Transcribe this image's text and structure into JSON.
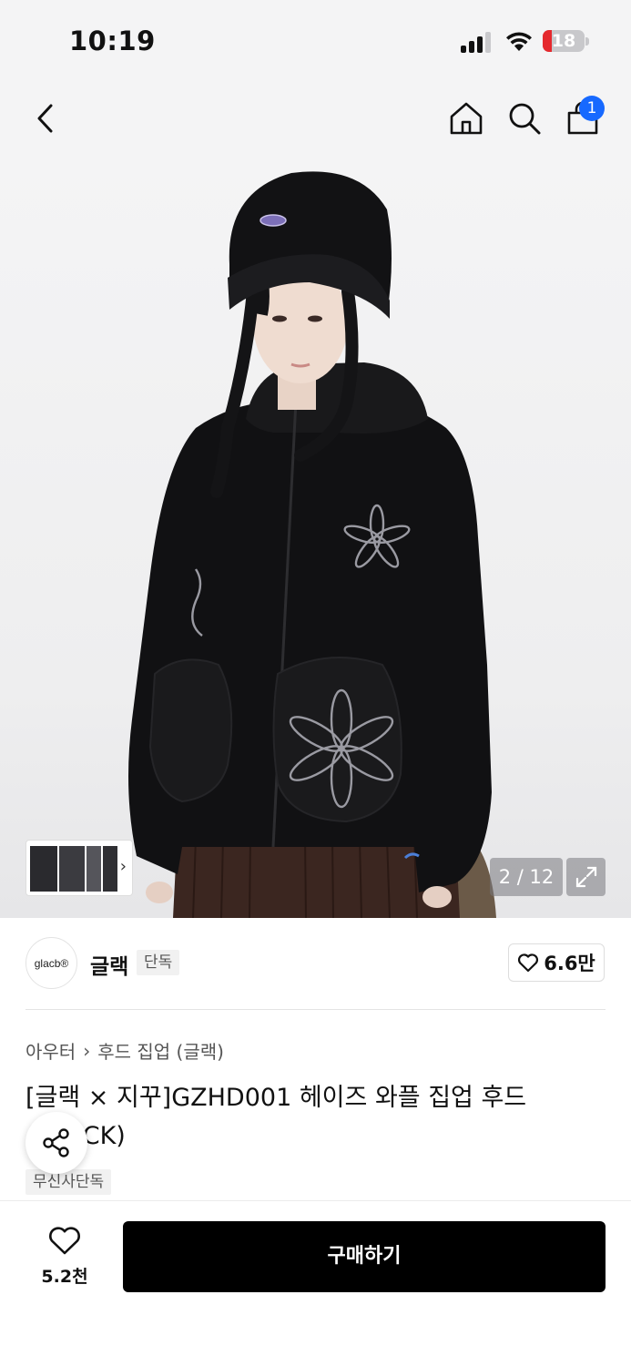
{
  "status_bar": {
    "time": "10:19",
    "battery": "18",
    "battery_color": "#e5292e"
  },
  "nav": {
    "back_icon": "chevron-left-icon",
    "home_icon": "home-icon",
    "search_icon": "search-icon",
    "cart_icon": "shopping-bag-icon",
    "cart_count": "1",
    "badge_color": "#1769ff"
  },
  "gallery": {
    "counter": "2 / 12",
    "current_image": 2,
    "total_images": 12,
    "expand_icon": "expand-icon",
    "thumb_arrow": "›"
  },
  "brand": {
    "logo_text": "glacb®",
    "name": "글랙",
    "tag": "단독",
    "likes": "6.6만"
  },
  "product": {
    "breadcrumb": [
      "아우터",
      "후드 집업 (글랙)"
    ],
    "breadcrumb_separator": "›",
    "title": "[글랙 × 지꾸]GZHD001 헤이즈 와플 집업 후드 (BLACK)",
    "exclusive_tag": "무신사단독"
  },
  "bottom_bar": {
    "wish_count": "5.2천",
    "buy_label": "구매하기"
  }
}
